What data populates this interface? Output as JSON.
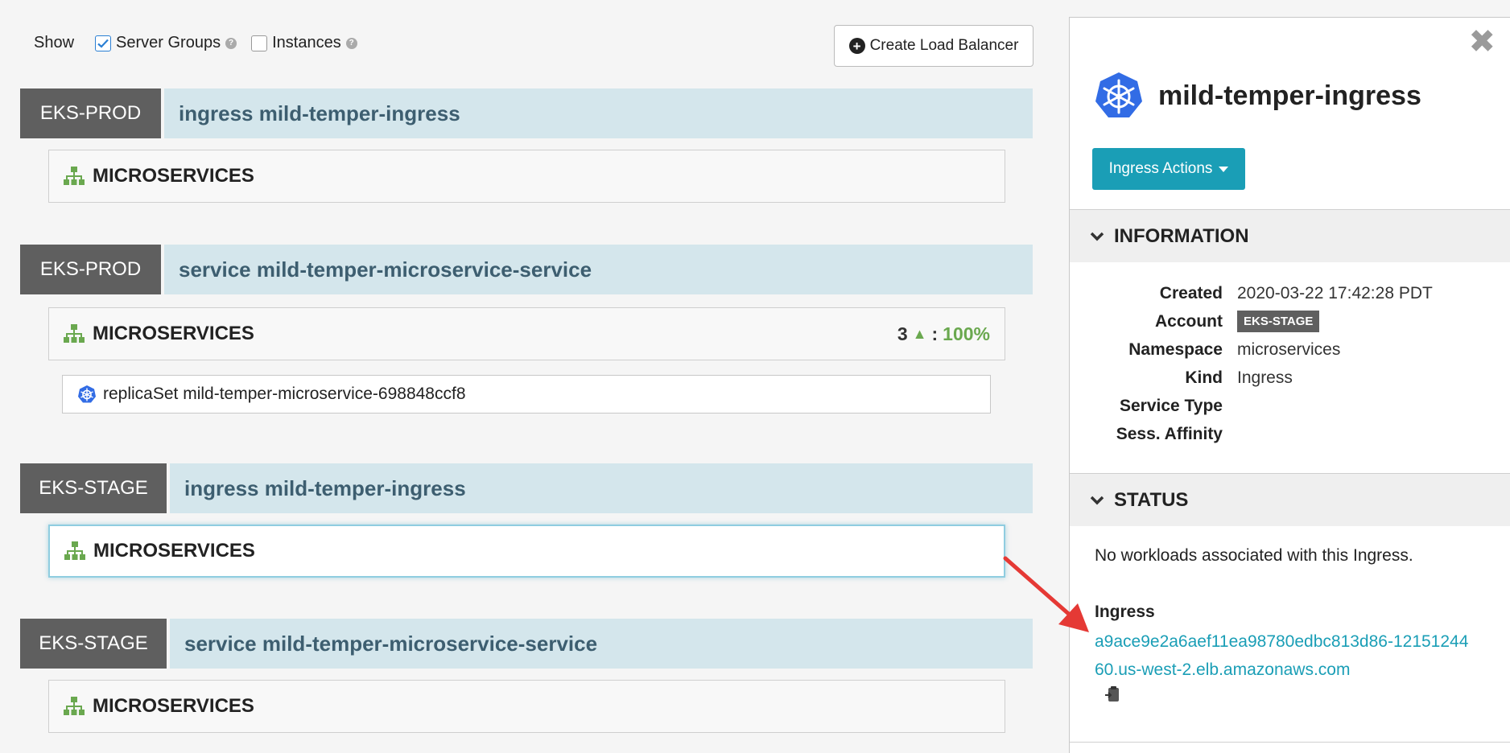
{
  "toolbar": {
    "show_label": "Show",
    "server_groups_label": "Server Groups",
    "server_groups_checked": true,
    "instances_label": "Instances",
    "instances_checked": false,
    "help_glyph": "?",
    "create_button_label": "Create Load Balancer",
    "create_button_icon": "plus-circle-icon"
  },
  "groups": [
    {
      "account": "EKS-PROD",
      "title": "ingress mild-temper-ingress",
      "cluster": "MICROSERVICES"
    },
    {
      "account": "EKS-PROD",
      "title": "service mild-temper-microservice-service",
      "cluster": "MICROSERVICES",
      "health": {
        "count": "3",
        "arrow": "▲",
        "sep": ":",
        "percent": "100%"
      },
      "replica": "replicaSet mild-temper-microservice-698848ccf8"
    },
    {
      "account": "EKS-STAGE",
      "title": "ingress mild-temper-ingress",
      "cluster": "MICROSERVICES",
      "selected": true
    },
    {
      "account": "EKS-STAGE",
      "title": "service mild-temper-microservice-service",
      "cluster": "MICROSERVICES"
    }
  ],
  "panel": {
    "close_glyph": "✖",
    "title": "mild-temper-ingress",
    "actions_label": "Ingress Actions",
    "information_header": "INFORMATION",
    "info": {
      "created_label": "Created",
      "created_value": "2020-03-22 17:42:28 PDT",
      "account_label": "Account",
      "account_value": "EKS-STAGE",
      "namespace_label": "Namespace",
      "namespace_value": "microservices",
      "kind_label": "Kind",
      "kind_value": "Ingress",
      "service_type_label": "Service Type",
      "affinity_label": "Sess. Affinity"
    },
    "status_header": "STATUS",
    "no_workloads": "No workloads associated with this Ingress.",
    "ingress_label": "Ingress",
    "ingress_host": "a9ace9e2a6aef11ea98780edbc813d86-1215124460.us-west-2.elb.amazonaws.com"
  },
  "colors": {
    "accent": "#1a9eb6",
    "account_badge": "#5f5f5f",
    "group_header_bg": "#d4e6ec",
    "health_green": "#6aa84f",
    "annotation_arrow": "#e53935"
  }
}
